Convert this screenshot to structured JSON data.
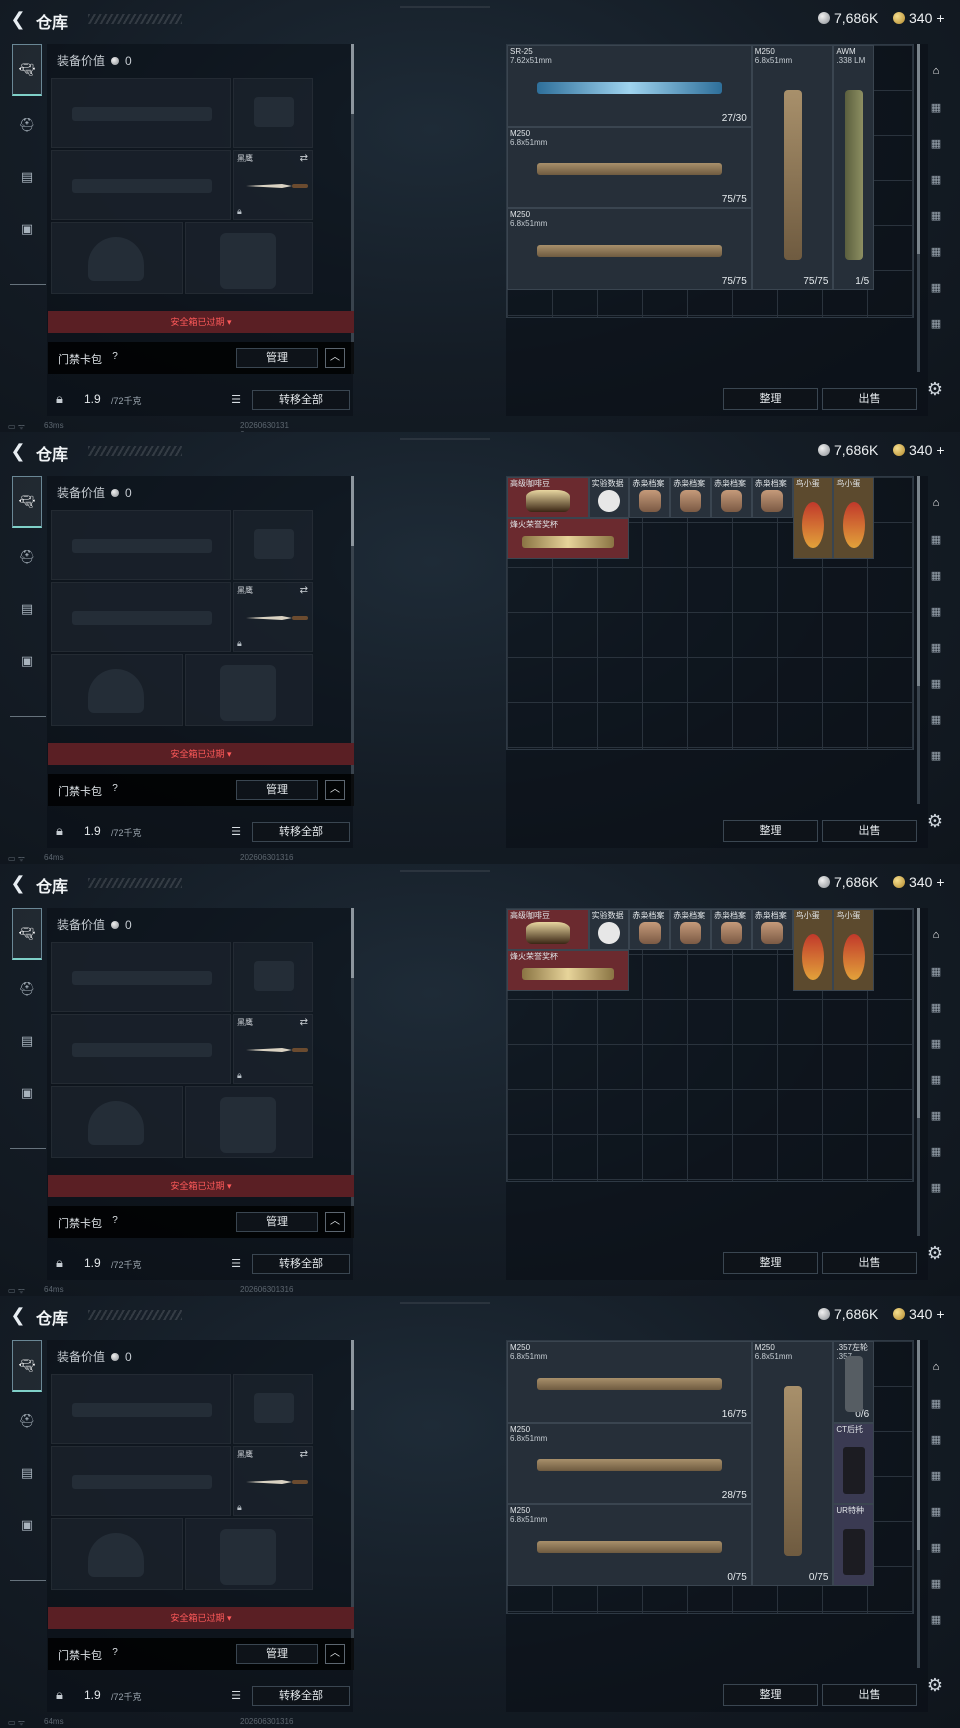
{
  "header": {
    "back_icon": "chevron-left-icon",
    "title": "仓库"
  },
  "currency": {
    "silver": "7,686K",
    "gold": "340",
    "gold_plus": "+"
  },
  "equip": {
    "value_label": "装备价值",
    "value": "0",
    "knife_name": "黑鹰",
    "safebox_expired": "安全箱已过期",
    "keycard_label": "门禁卡包",
    "keycard_help": "?",
    "manage_button": "管理",
    "weight_value": "1.9",
    "weight_capacity": "/72千克",
    "transfer_all_button": "转移全部"
  },
  "stash_buttons": {
    "sort": "整理",
    "sell": "出售"
  },
  "panels": [
    {
      "status_ms": "63ms",
      "status_id": "20260630131​6",
      "weapons": [
        {
          "name": "SR-25",
          "caliber": "7.62x51mm",
          "ammo": "27/30"
        },
        {
          "name": "M250",
          "caliber": "6.8x51mm",
          "ammo": "75/75"
        },
        {
          "name": "M250",
          "caliber": "6.8x51mm",
          "ammo": "75/75"
        },
        {
          "name": "M250",
          "caliber": "6.8x51mm",
          "ammo": "75/75"
        },
        {
          "name": "AWM",
          "caliber": ".338 LM",
          "ammo": "1/5"
        }
      ]
    },
    {
      "status_ms": "64ms",
      "status_id": "202606301316",
      "collectibles": [
        {
          "name": "高级咖啡豆"
        },
        {
          "name": "实验数据"
        },
        {
          "name": "赤枭档案"
        },
        {
          "name": "赤枭档案"
        },
        {
          "name": "赤枭档案"
        },
        {
          "name": "赤枭档案"
        },
        {
          "name": "鸟小蛋"
        },
        {
          "name": "鸟小蛋"
        },
        {
          "name": "烽火荣誉奖杯"
        }
      ]
    },
    {
      "status_ms": "64ms",
      "status_id": "202606301316",
      "collectibles": [
        {
          "name": "高级咖啡豆"
        },
        {
          "name": "实验数据"
        },
        {
          "name": "赤枭档案"
        },
        {
          "name": "赤枭档案"
        },
        {
          "name": "赤枭档案"
        },
        {
          "name": "赤枭档案"
        },
        {
          "name": "鸟小蛋"
        },
        {
          "name": "鸟小蛋"
        },
        {
          "name": "烽火荣誉奖杯"
        }
      ]
    },
    {
      "status_ms": "64ms",
      "status_id": "202606301316",
      "weapons": [
        {
          "name": "M250",
          "caliber": "6.8x51mm",
          "ammo": "16/75"
        },
        {
          "name": "M250",
          "caliber": "6.8x51mm",
          "ammo": "28/75"
        },
        {
          "name": "M250",
          "caliber": "6.8x51mm",
          "ammo": "0/75"
        },
        {
          "name": "M250",
          "caliber": "6.8x51mm",
          "ammo": "0/75"
        },
        {
          "name": ".357左轮",
          "caliber": ".357",
          "ammo": "0/6"
        },
        {
          "name": "CT后托",
          "caliber": "",
          "ammo": ""
        },
        {
          "name": "UR特种",
          "caliber": "",
          "ammo": ""
        }
      ]
    }
  ]
}
